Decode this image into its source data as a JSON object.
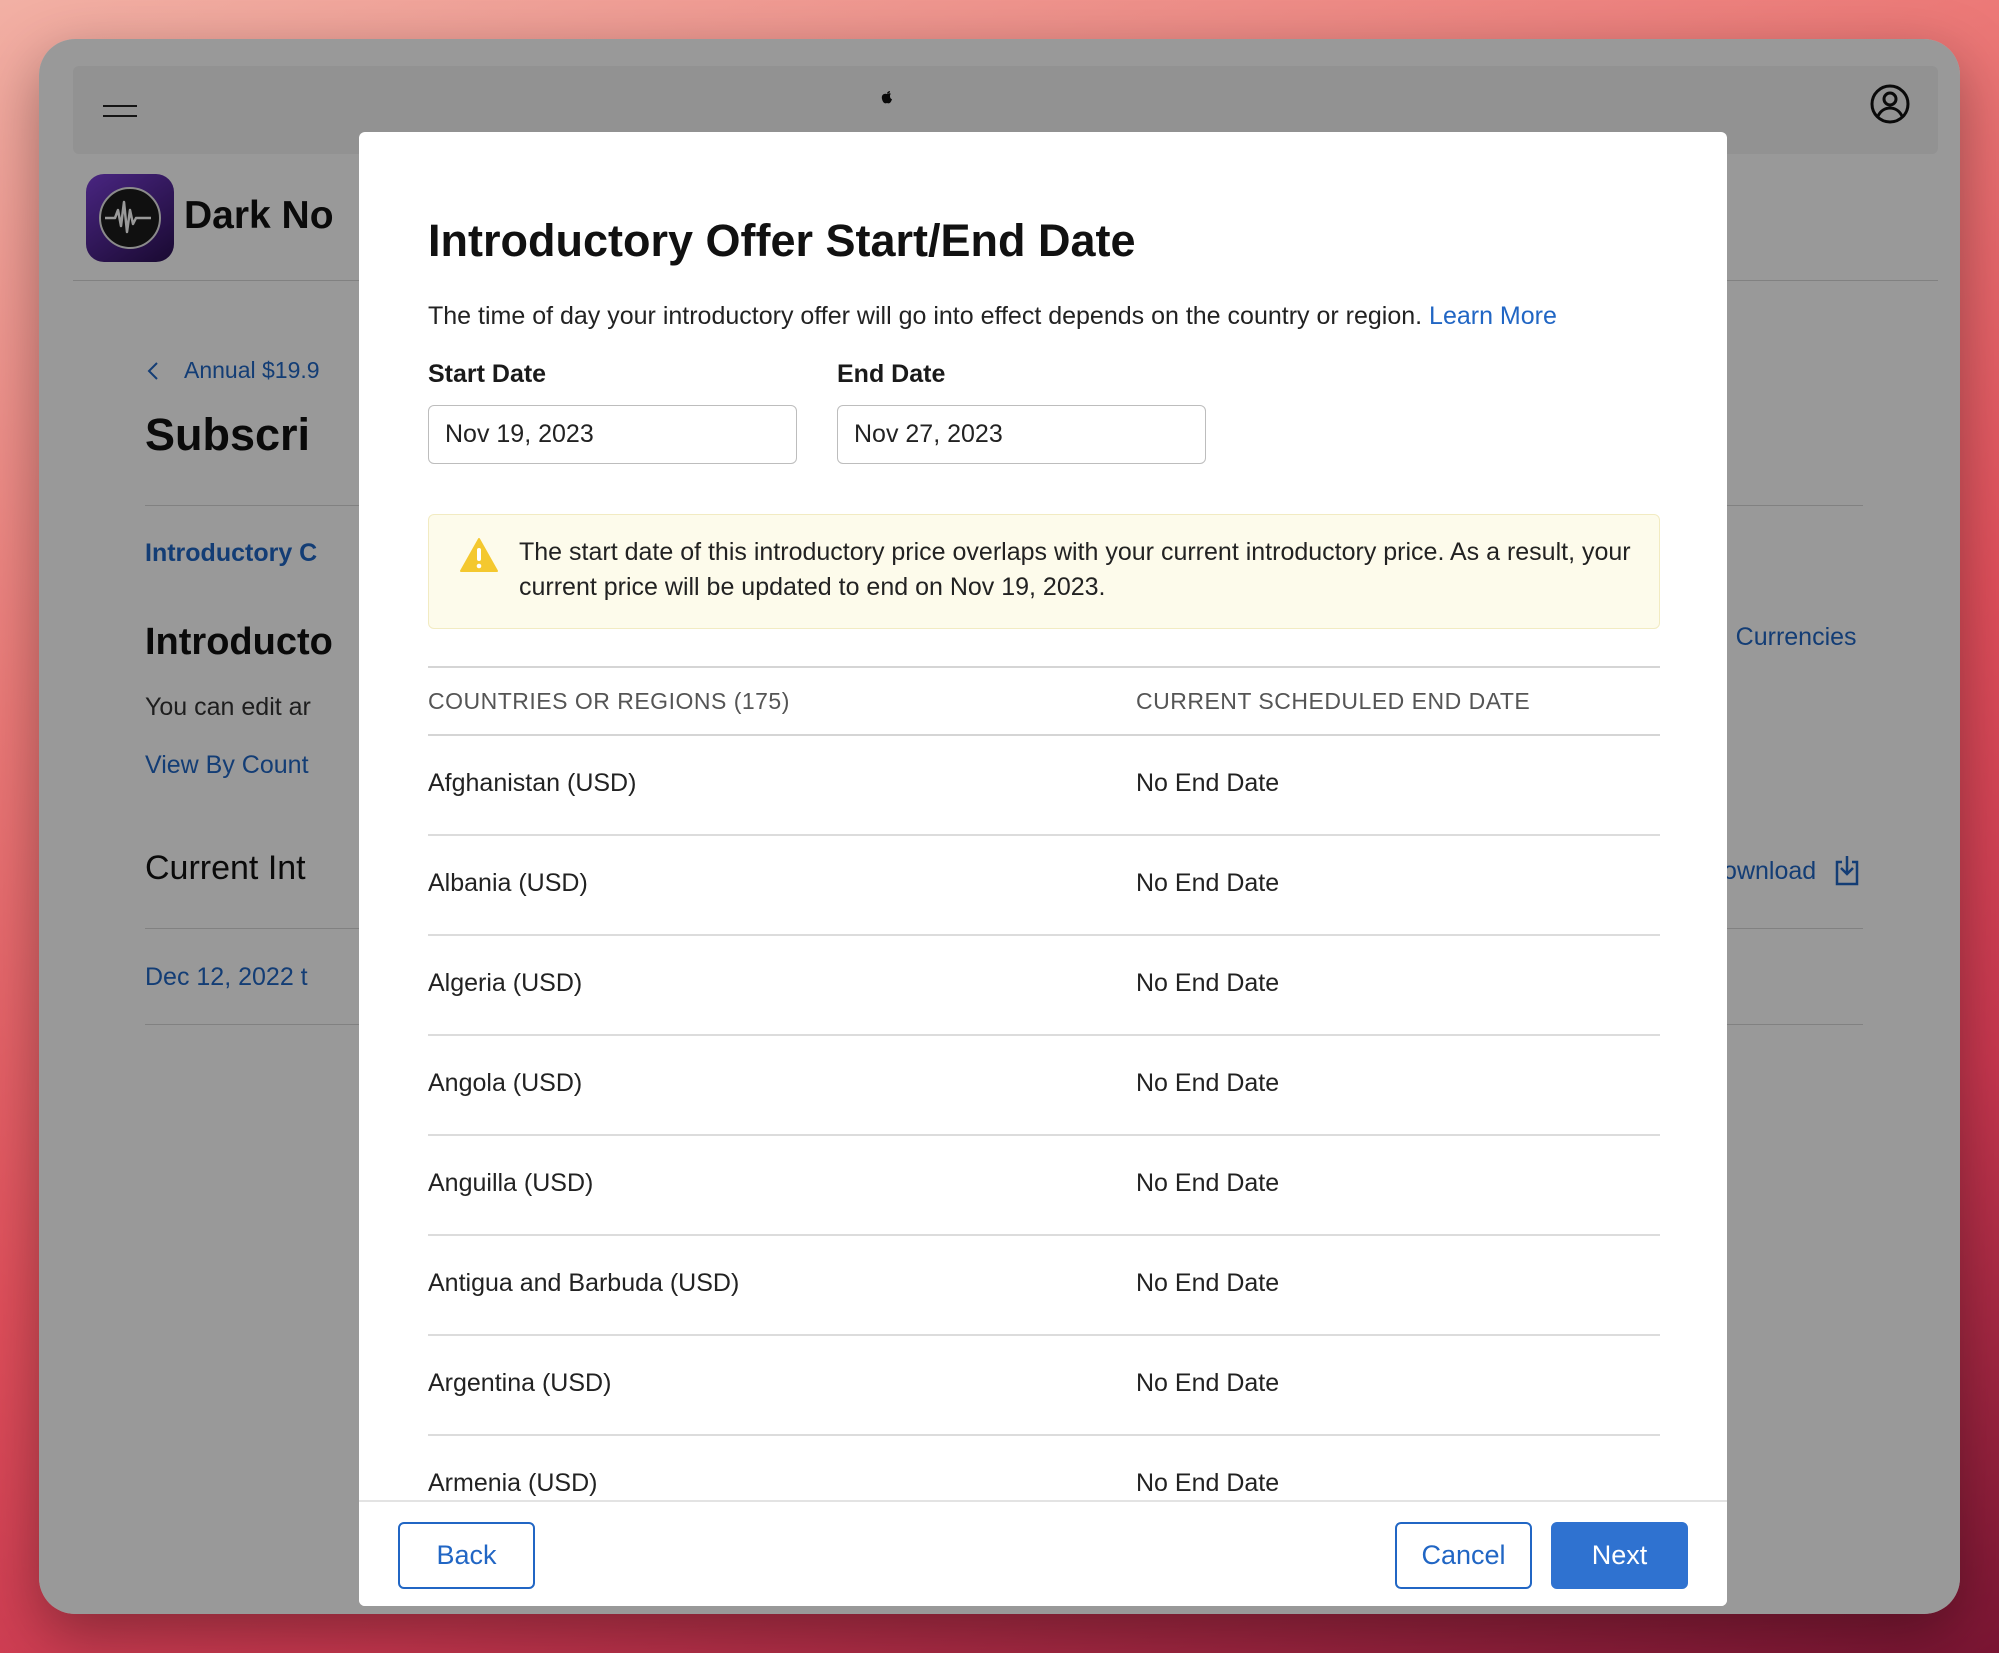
{
  "background": {
    "app_name": "Dark No",
    "breadcrumb": "Annual $19.9",
    "page_title": "Subscri",
    "section_link": "Introductory C",
    "section_heading": "Introducto",
    "section_desc": "You can edit ar",
    "view_link": "View By Count",
    "current_heading": "Current Int",
    "date_link": "Dec 12, 2022 t",
    "currencies_link": "and Currencies",
    "download_label": "Download"
  },
  "modal": {
    "title": "Introductory Offer Start/End Date",
    "description": "The time of day your introductory offer will go into effect depends on the country or region.",
    "learn_more": "Learn More",
    "start_date_label": "Start Date",
    "start_date_value": "Nov 19, 2023",
    "end_date_label": "End Date",
    "end_date_value": "Nov 27, 2023",
    "warning": "The start date of this introductory price overlaps with your current introductory price. As a result, your current price will be updated to end on Nov 19, 2023.",
    "table": {
      "columns": [
        "COUNTRIES OR REGIONS (175)",
        "CURRENT SCHEDULED END DATE"
      ],
      "rows": [
        [
          "Afghanistan (USD)",
          "No End Date"
        ],
        [
          "Albania (USD)",
          "No End Date"
        ],
        [
          "Algeria (USD)",
          "No End Date"
        ],
        [
          "Angola (USD)",
          "No End Date"
        ],
        [
          "Anguilla (USD)",
          "No End Date"
        ],
        [
          "Antigua and Barbuda (USD)",
          "No End Date"
        ],
        [
          "Argentina (USD)",
          "No End Date"
        ],
        [
          "Armenia (USD)",
          "No End Date"
        ]
      ]
    },
    "buttons": {
      "back": "Back",
      "cancel": "Cancel",
      "next": "Next"
    }
  },
  "colors": {
    "accent": "#2f72d0",
    "link": "#2166c4",
    "warning_bg": "#fdfbeb",
    "warning_icon": "#f4c82f"
  },
  "icons": {
    "menu": "hamburger-menu-icon",
    "account": "account-circle-icon",
    "back_arrow": "chevron-left-icon",
    "warning": "warning-triangle-icon",
    "download": "download-icon",
    "app": "waveform-app-icon"
  }
}
